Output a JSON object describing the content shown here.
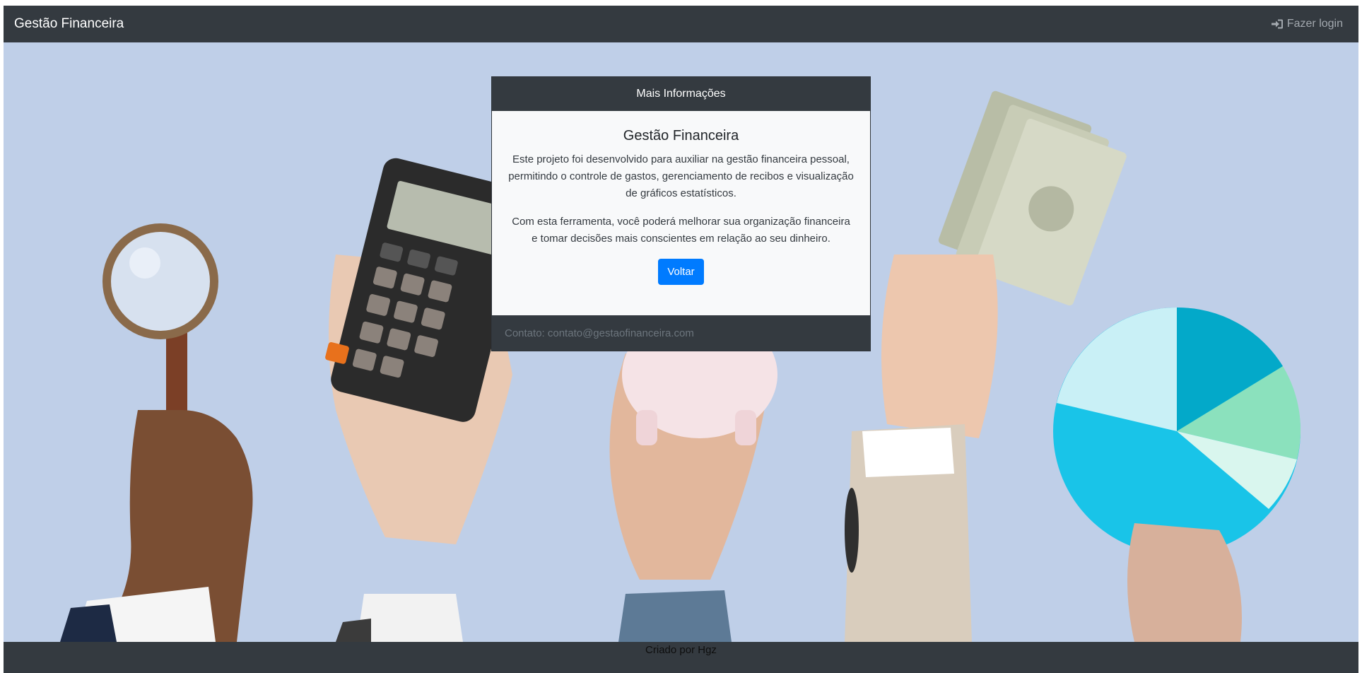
{
  "navbar": {
    "brand": "Gestão Financeira",
    "login_icon": "sign-in-icon",
    "login_label": "Fazer login"
  },
  "card": {
    "header": "Mais Informações",
    "title": "Gestão Financeira",
    "paragraphs": [
      "Este projeto foi desenvolvido para auxiliar na gestão financeira pessoal, permitindo o controle de gastos, gerenciamento de recibos e visualização de gráficos estatísticos.",
      "Com esta ferramenta, você poderá melhorar sua organização financeira e tomar decisões mais conscientes em relação ao seu dinheiro."
    ],
    "button_label": "Voltar",
    "footer": "Contato: contato@gestaofinanceira.com"
  },
  "footer": {
    "credit": "Criado por Hgz"
  },
  "colors": {
    "navbar_bg": "#343a40",
    "hero_bg": "#bfcfe8",
    "card_bg": "#f8f9fa",
    "primary_button": "#007bff"
  }
}
